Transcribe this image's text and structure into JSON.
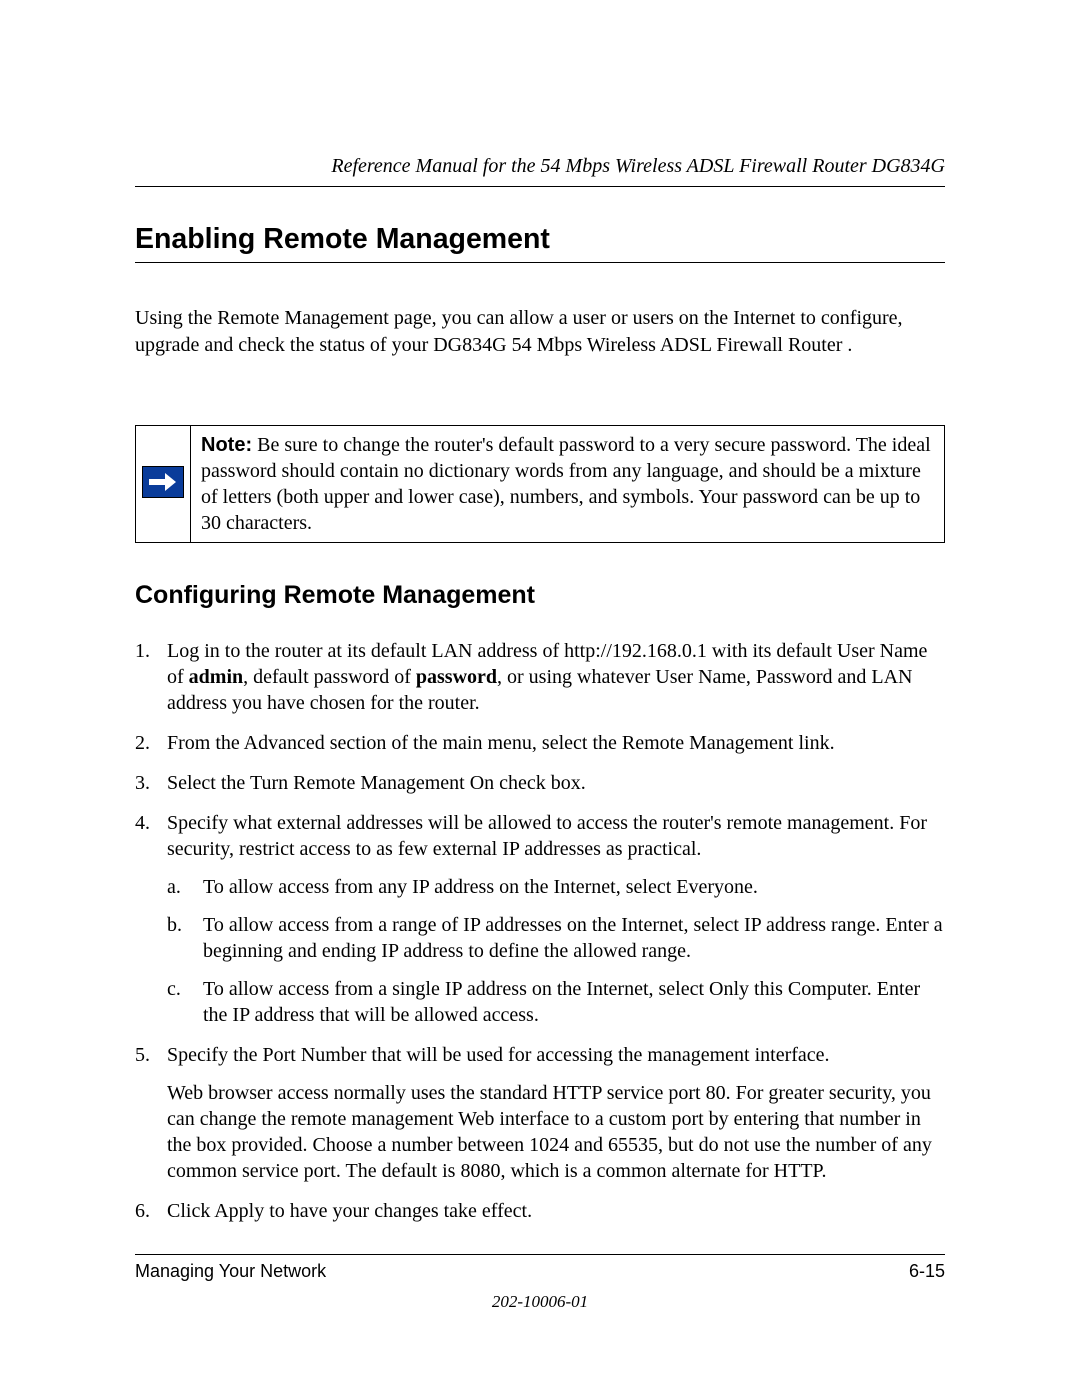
{
  "header": {
    "running": "Reference Manual for the 54 Mbps Wireless ADSL Firewall Router DG834G"
  },
  "section": {
    "title": "Enabling Remote Management",
    "intro": "Using the Remote Management page, you can allow a user or users on the Internet to configure, upgrade and check the status of your DG834G 54 Mbps Wireless ADSL Firewall Router ."
  },
  "note": {
    "label": "Note:",
    "text": " Be sure to change the router's default password to a very secure password. The ideal password should contain no dictionary words from any language, and should be a mixture of letters (both upper and lower case), numbers, and symbols. Your password can be up to 30 characters."
  },
  "subsection": {
    "title": "Configuring Remote Management"
  },
  "steps": {
    "s1a": "Log in to the router at its default LAN address of http://192.168.0.1 with its default User Name of ",
    "s1b": "admin",
    "s1c": ", default password of ",
    "s1d": "password",
    "s1e": ", or using whatever User Name, Password and LAN address you have chosen for the router.",
    "s2": "From the Advanced section of the main menu, select the Remote Management link.",
    "s3": "Select the Turn Remote Management On check box.",
    "s4": "Specify what external addresses will be allowed to access the router's remote management. For security, restrict access to as few external IP addresses as practical.",
    "s4a": "To allow access from any IP address on the Internet, select Everyone.",
    "s4b": "To allow access from a range of IP addresses on the Internet, select IP address range. Enter a beginning and ending IP address to define the allowed range.",
    "s4c": "To allow access from a single IP address on the Internet, select Only this Computer. Enter the IP address that will be allowed access.",
    "s5": "Specify the Port Number that will be used for accessing the management interface.",
    "s5p": "Web browser access normally uses the standard HTTP service port 80. For greater security, you can change the remote management Web interface to a custom port by entering that number in the box provided. Choose a number between 1024 and 65535, but do not use the number of any common service port. The default is 8080, which is a common alternate for HTTP.",
    "s6": "Click Apply to have your changes take effect."
  },
  "footer": {
    "left": "Managing Your Network",
    "right": "6-15",
    "docnum": "202-10006-01"
  }
}
